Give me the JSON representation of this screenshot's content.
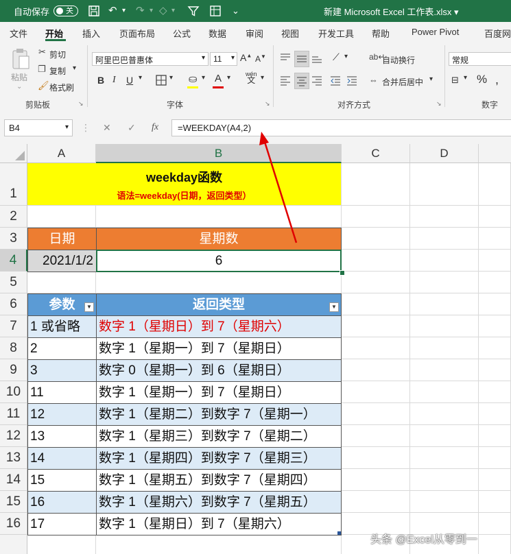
{
  "titlebar": {
    "autosave_label": "自动保存",
    "autosave_state": "关",
    "doc_title": "新建 Microsoft Excel 工作表.xlsx",
    "title_caret": "▾",
    "bg_color": "#217346"
  },
  "menu": [
    "文件",
    "开始",
    "插入",
    "页面布局",
    "公式",
    "数据",
    "审阅",
    "视图",
    "开发工具",
    "帮助",
    "Power Pivot",
    "百度网"
  ],
  "ribbon": {
    "clipboard": {
      "paste": "粘贴",
      "cut": "剪切",
      "copy": "复制",
      "format_painter": "格式刷",
      "group": "剪贴板"
    },
    "font": {
      "font_name": "阿里巴巴普惠体",
      "font_size": "11",
      "bold": "B",
      "italic": "I",
      "underline": "U",
      "font_color_letter": "A",
      "font_color": "#e00000",
      "group": "字体"
    },
    "alignment": {
      "wrap_text": "自动换行",
      "merge_center": "合并后居中",
      "group": "对齐方式"
    },
    "number": {
      "format": "常规",
      "group": "数字"
    }
  },
  "formula_bar": {
    "name_box": "B4",
    "fx": "fx",
    "formula": "=WEEKDAY(A4,2)"
  },
  "columns": [
    "A",
    "B",
    "C",
    "D"
  ],
  "rows": [
    "1",
    "2",
    "3",
    "4",
    "5",
    "6",
    "7",
    "8",
    "9",
    "10",
    "11",
    "12",
    "13",
    "14",
    "15",
    "16"
  ],
  "sheet": {
    "title": "weekday函数",
    "syntax": "语法=weekday(日期，返回类型）",
    "date_header": "日期",
    "weekday_header": "星期数",
    "date_value": "2021/1/2",
    "weekday_value": "6",
    "param_header": "参数",
    "return_header": "返回类型",
    "table": [
      {
        "param": "1 或省略",
        "ret": "数字 1（星期日）到 7（星期六）"
      },
      {
        "param": "2",
        "ret": "数字 1（星期一）到 7（星期日）"
      },
      {
        "param": "3",
        "ret": "数字 0（星期一）到 6（星期日）"
      },
      {
        "param": "11",
        "ret": "数字 1（星期一）到 7（星期日）"
      },
      {
        "param": "12",
        "ret": "数字 1（星期二）到数字 7（星期一）"
      },
      {
        "param": "13",
        "ret": "数字 1（星期三）到数字 7（星期二）"
      },
      {
        "param": "14",
        "ret": "数字 1（星期四）到数字 7（星期三）"
      },
      {
        "param": "15",
        "ret": "数字 1（星期五）到数字 7（星期四）"
      },
      {
        "param": "16",
        "ret": "数字 1（星期六）到数字 7（星期五）"
      },
      {
        "param": "17",
        "ret": "数字 1（星期日）到 7（星期六）"
      }
    ],
    "colors": {
      "title_bg": "#ffff00",
      "syntax_text": "#e00000",
      "orange_header": "#ed7d31",
      "blue_header": "#5b9bd5",
      "band": "#ddebf7",
      "highlight_text": "#e00000",
      "arrow": "#e00000"
    }
  },
  "watermark": "头条 @Excel从零到一"
}
